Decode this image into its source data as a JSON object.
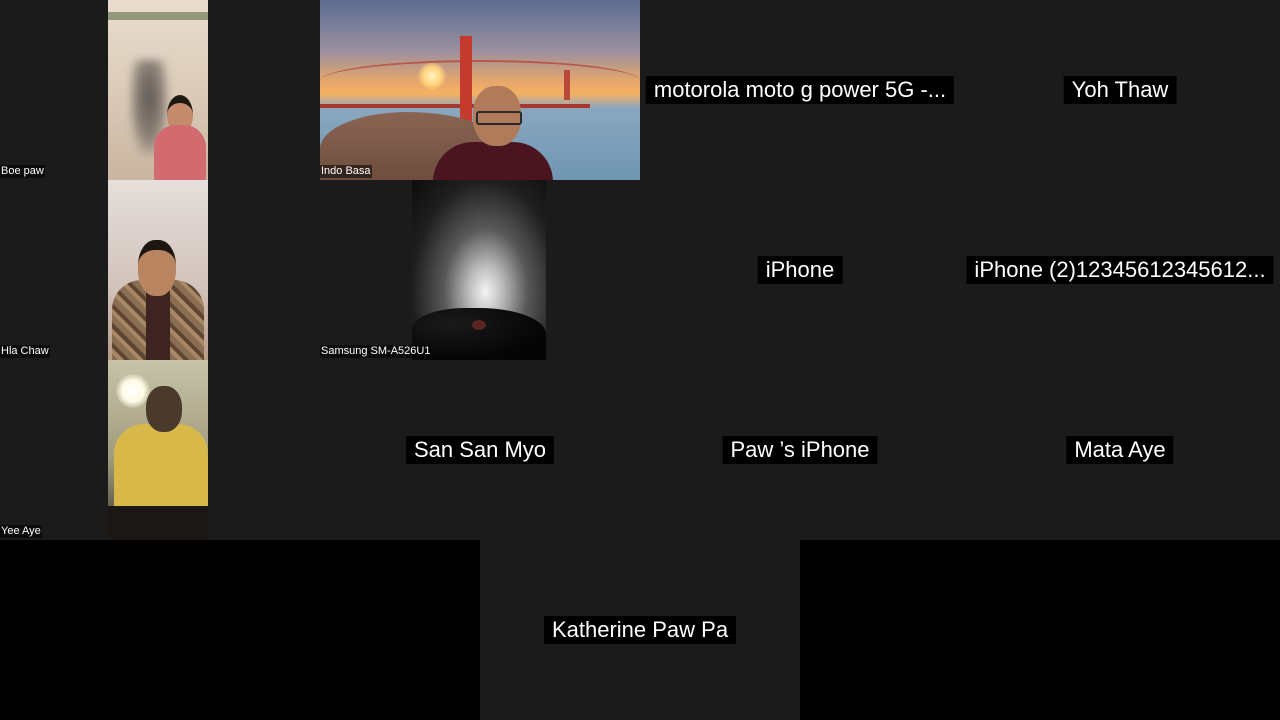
{
  "meeting": {
    "view": "gallery",
    "participants": [
      {
        "name": "Boe paw",
        "video": true
      },
      {
        "name": "Indo Basa",
        "video": true
      },
      {
        "name": "motorola moto g power 5G -...",
        "video": false
      },
      {
        "name": "Yoh Thaw",
        "video": false
      },
      {
        "name": "Hla Chaw",
        "video": true
      },
      {
        "name": "Samsung SM-A526U1",
        "video": true
      },
      {
        "name": "iPhone",
        "video": false
      },
      {
        "name": "iPhone (2)12345612345612...",
        "video": false
      },
      {
        "name": "Yee Aye",
        "video": true
      },
      {
        "name": "San San Myo",
        "video": false
      },
      {
        "name": "Paw ’s iPhone",
        "video": false
      },
      {
        "name": "Mata Aye",
        "video": false
      },
      {
        "name": "Katherine Paw Pa",
        "video": false
      }
    ]
  },
  "colors": {
    "tile_background": "#1b1b1b",
    "page_background": "#000000",
    "name_text": "#ffffff",
    "name_label_background": "#000000"
  }
}
